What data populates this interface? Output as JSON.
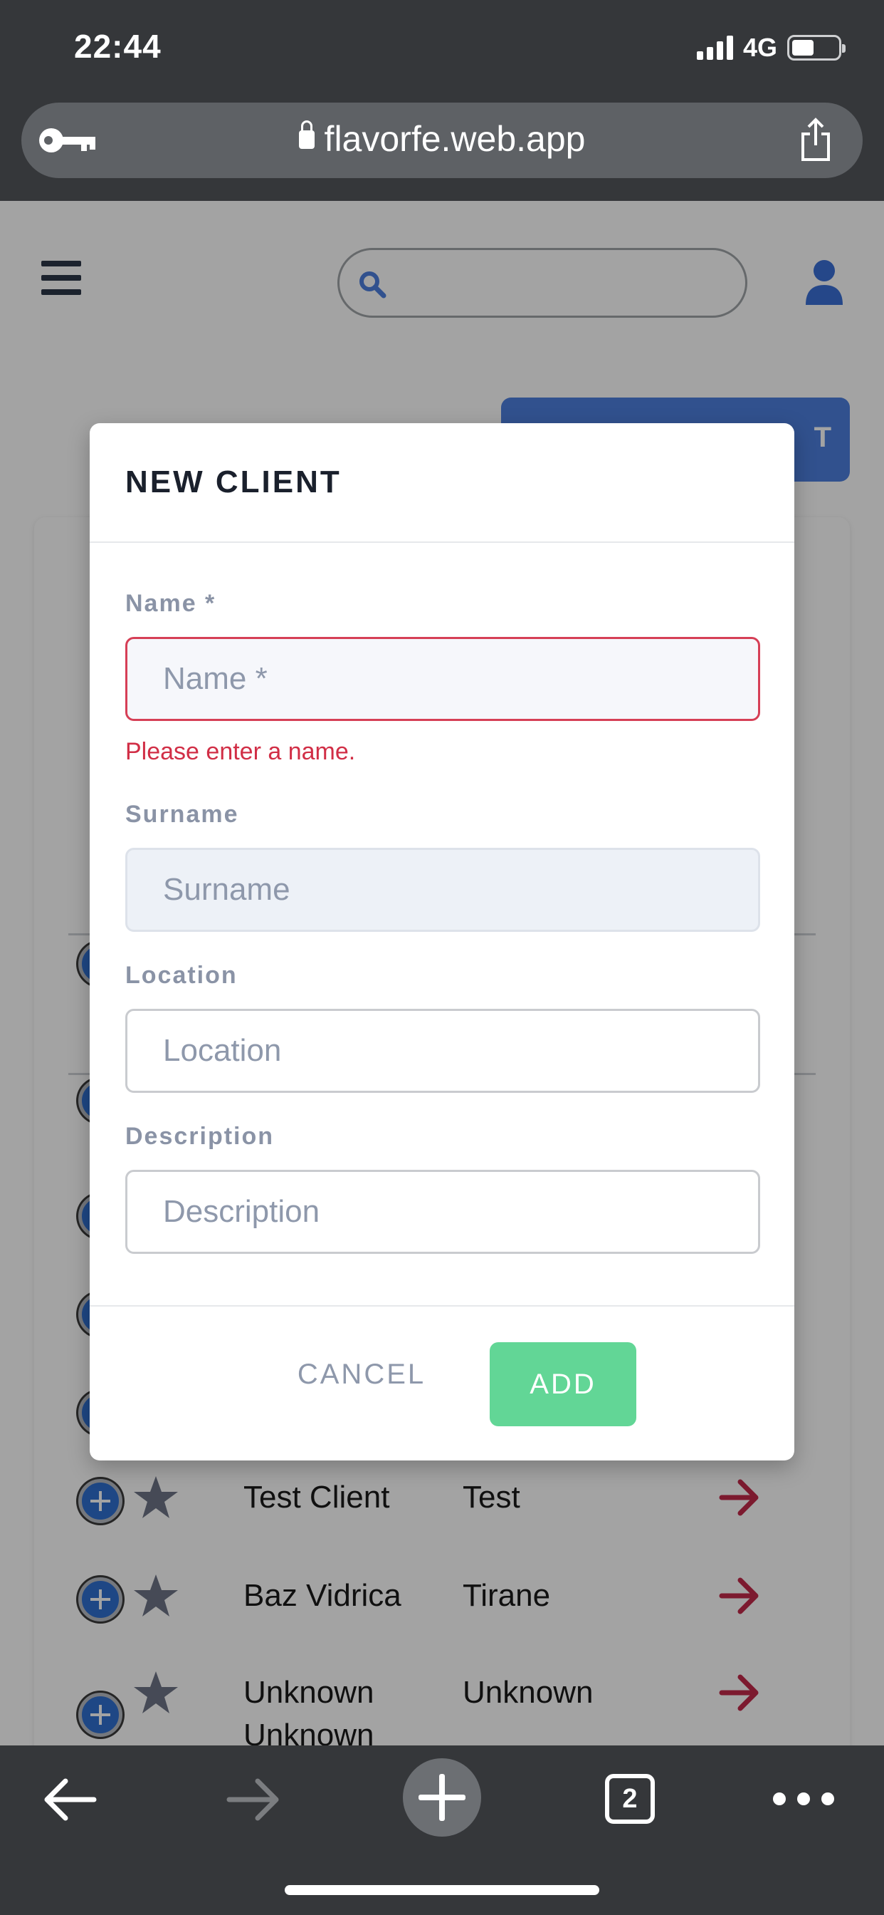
{
  "status_bar": {
    "time": "22:44",
    "network": "4G",
    "battery_level": 0.48
  },
  "browser": {
    "url": "flavorfe.web.app",
    "tab_count": "2"
  },
  "app": {
    "search_placeholder": "",
    "top_button_label": "T"
  },
  "client_list": [
    {
      "name": "Test Client",
      "location": "Test"
    },
    {
      "name": "Baz Vidrica",
      "location": "Tirane"
    },
    {
      "name": "Unknown Unknown",
      "location": "Unknown"
    }
  ],
  "modal": {
    "title": "NEW CLIENT",
    "fields": {
      "name": {
        "label": "Name *",
        "placeholder": "Name *",
        "value": "",
        "error": "Please enter a name."
      },
      "surname": {
        "label": "Surname",
        "placeholder": "Surname",
        "value": ""
      },
      "location": {
        "label": "Location",
        "placeholder": "Location",
        "value": ""
      },
      "description": {
        "label": "Description",
        "placeholder": "Description",
        "value": ""
      }
    },
    "cancel_label": "CANCEL",
    "add_label": "ADD"
  },
  "colors": {
    "primary": "#4d7fde",
    "error": "#d12e46",
    "add_button": "#62d696",
    "arrow": "#c2294a"
  }
}
